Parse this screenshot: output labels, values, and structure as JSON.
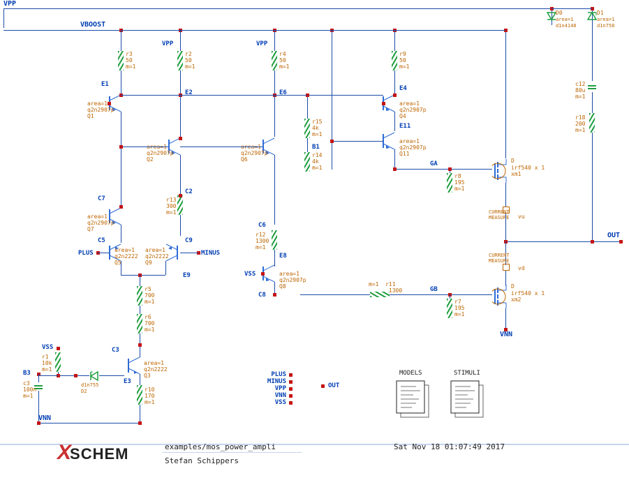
{
  "footer": {
    "brand_x": "X",
    "brand_rest": "SCHEM",
    "path": "examples/mos_power_ampli",
    "author": "Stefan Schippers",
    "timestamp": "Sat Nov 18 01:07:49 2017"
  },
  "rails": {
    "vpp_top": "VPP",
    "vpp_mid1": "VPP",
    "vpp_mid2": "VPP",
    "vboost": "VBOOST",
    "vnn_bottom_left": "VNN",
    "vnn_bottom_right": "VNN",
    "vss_left": "VSS",
    "vss_mid": "VSS",
    "out": "OUT",
    "ga": "GA",
    "gb": "GB"
  },
  "transistors": {
    "q1": {
      "ref": "E1",
      "model": "q2n2907p",
      "inst": "Q1",
      "area": "area=1"
    },
    "q2": {
      "ref": "E2",
      "model": "q2n2907p",
      "inst": "Q2",
      "area": "area=1"
    },
    "q4": {
      "ref": "E4",
      "model": "q2n2907p",
      "inst": "Q4",
      "area": "area=1"
    },
    "q6": {
      "ref": "E6",
      "model": "q2n2907p",
      "inst": "Q6",
      "area": "area=1"
    },
    "q7": {
      "ref": "C7",
      "model": "q2n2907p",
      "inst": "Q7",
      "area": "area=1"
    },
    "q8": {
      "ref": "E8",
      "model": "q2n2907p",
      "inst": "Q8",
      "area": "area=1"
    },
    "q11": {
      "ref": "E11",
      "model": "q2n2907p",
      "inst": "Q11",
      "area": "area=1"
    },
    "q3": {
      "ref": "C3",
      "model": "q2n2222",
      "inst": "Q3",
      "area": "area=1"
    },
    "q5": {
      "ref": "C5",
      "model": "q2n2222",
      "inst": "Q5",
      "area": "area=1"
    },
    "q9": {
      "ref": "C9",
      "model": "q2n2222",
      "inst": "Q9",
      "area": "area=1"
    },
    "b1": {
      "ref": "B1",
      "model": "",
      "inst": "",
      "area": ""
    },
    "b3": {
      "ref": "B3",
      "model": "",
      "inst": "",
      "area": ""
    },
    "c2": {
      "ref": "C2"
    },
    "c6": {
      "ref": "C6"
    },
    "c8": {
      "ref": "C8"
    },
    "e3": {
      "ref": "E3"
    },
    "e9": {
      "ref": "E9"
    }
  },
  "mosfets": {
    "xm1": {
      "model": "irf540 x 1",
      "inst": "xm1",
      "d": "D"
    },
    "xm2": {
      "model": "irf540 x 1",
      "inst": "xm2",
      "d": "D"
    }
  },
  "resistors": {
    "r1": {
      "name": "r1",
      "val": "10k",
      "m": "m=1"
    },
    "r2": {
      "name": "r2",
      "val": "50",
      "m": "m=1"
    },
    "r3": {
      "name": "r3",
      "val": "50",
      "m": "m=1"
    },
    "r4": {
      "name": "r4",
      "val": "50",
      "m": "m=1"
    },
    "r5": {
      "name": "r5",
      "val": "700",
      "m": "m=1"
    },
    "r6": {
      "name": "r6",
      "val": "700",
      "m": "m=1"
    },
    "r7": {
      "name": "r7",
      "val": "195",
      "m": "m=1"
    },
    "r8": {
      "name": "r8",
      "val": "195",
      "m": "m=1"
    },
    "r9": {
      "name": "r9",
      "val": "50",
      "m": "m=1"
    },
    "r10": {
      "name": "r10",
      "val": "170",
      "m": "m=1"
    },
    "r11": {
      "name": "r11",
      "val": "1300",
      "m": "m=1"
    },
    "r12": {
      "name": "r12",
      "val": "1300",
      "m": "m=1"
    },
    "r13": {
      "name": "r13",
      "val": "300",
      "m": "m=1"
    },
    "r14": {
      "name": "r14",
      "val": "4k",
      "m": "m=1"
    },
    "r15": {
      "name": "r15",
      "val": "4k",
      "m": "m=1"
    },
    "r18": {
      "name": "r18",
      "val": "200",
      "m": "m=1"
    }
  },
  "diodes": {
    "d0": {
      "name": "D0",
      "model": "d1n4148",
      "area": "area=1"
    },
    "d1": {
      "name": "D1",
      "model": "d1n758",
      "area": "area=1"
    },
    "d2": {
      "name": "D2",
      "model": "d1n755"
    }
  },
  "caps": {
    "c3": {
      "name": "c3",
      "val": "100n",
      "m": "m=1"
    },
    "c12": {
      "name": "c12",
      "val": "80u",
      "m": "m=1"
    }
  },
  "measures": {
    "vu": "vu",
    "vd": "vd",
    "cm": "CURRENT\nMEASURE"
  },
  "pins_block": {
    "plus": "PLUS",
    "minus": "MINUS",
    "vpp": "VPP",
    "vnn": "VNN",
    "vss": "VSS",
    "out": "OUT"
  },
  "io": {
    "plus": "PLUS",
    "minus": "MINUS"
  },
  "docs": {
    "models": "MODELS",
    "stimuli": "STIMULI"
  }
}
